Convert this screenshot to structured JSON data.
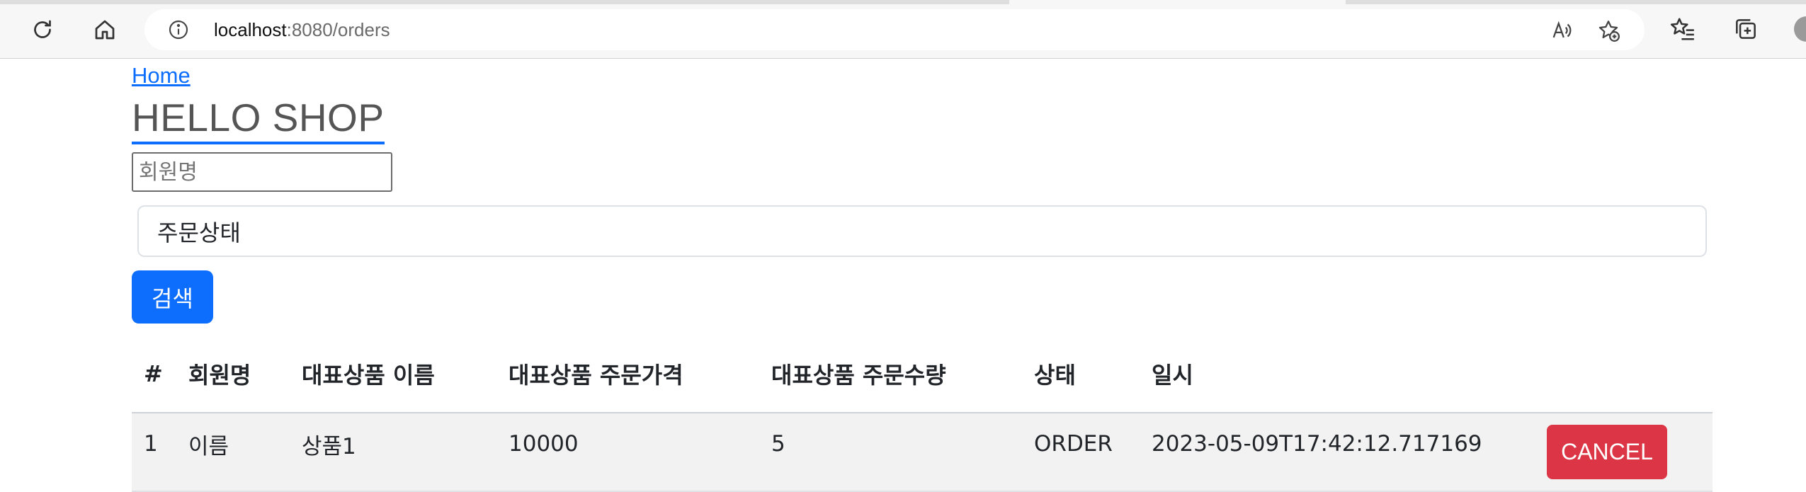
{
  "browser": {
    "url_host": "localhost",
    "url_path": ":8080/orders",
    "icons": [
      "refresh-icon",
      "home-icon",
      "site-info-icon",
      "read-aloud-icon",
      "add-favorite-icon",
      "favorites-icon",
      "collections-icon",
      "profile-avatar"
    ]
  },
  "nav": {
    "home_label": "Home",
    "brand_label": "HELLO SHOP"
  },
  "search_form": {
    "member_placeholder": "회원명",
    "member_value": "",
    "status_selected": "주문상태",
    "search_button": "검색"
  },
  "table": {
    "headers": [
      "#",
      "회원명",
      "대표상품 이름",
      "대표상품 주문가격",
      "대표상품 주문수량",
      "상태",
      "일시"
    ],
    "rows": [
      {
        "id": "1",
        "member": "이름",
        "item_name": "상품1",
        "price": "10000",
        "count": "5",
        "status": "ORDER",
        "date": "2023-05-09T17:42:12.717169",
        "action": "CANCEL"
      }
    ]
  },
  "colors": {
    "primary": "#0d6efd",
    "danger": "#dc3545",
    "row_stripe": "#f2f2f2"
  }
}
